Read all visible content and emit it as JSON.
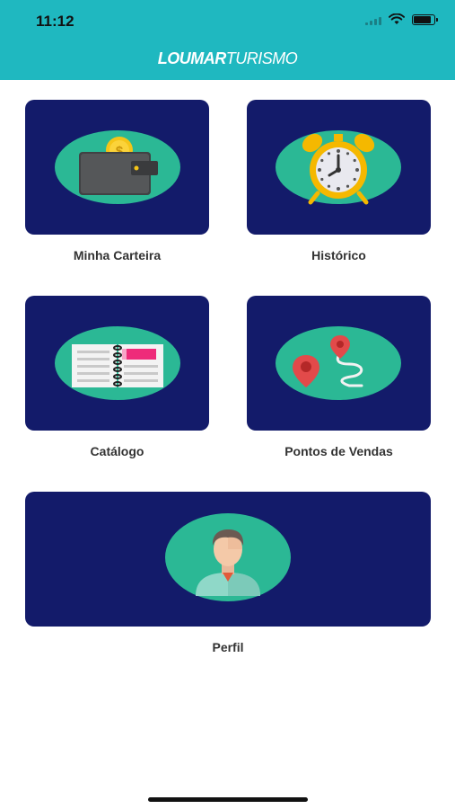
{
  "status_bar": {
    "time": "11:12"
  },
  "header": {
    "logo_bold": "LOUMAR",
    "logo_light": "TURISMO",
    "background": "#1fb8c0"
  },
  "menu": {
    "card_color": "#131b6a",
    "oval_color": "#2bb895",
    "items": [
      {
        "label": "Minha Carteira",
        "icon": "wallet-icon"
      },
      {
        "label": "Histórico",
        "icon": "alarm-clock-icon"
      },
      {
        "label": "Catálogo",
        "icon": "catalog-book-icon"
      },
      {
        "label": "Pontos de Vendas",
        "icon": "map-route-icon"
      },
      {
        "label": "Perfil",
        "icon": "user-profile-icon"
      }
    ]
  }
}
